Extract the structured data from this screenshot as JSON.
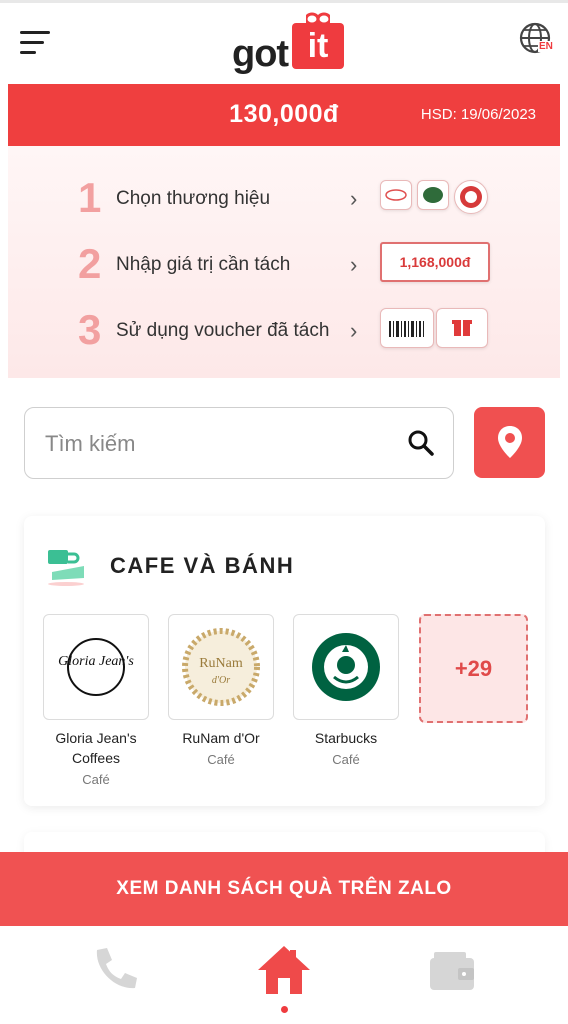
{
  "header": {
    "logo_text": "got",
    "logo_box_text": "it",
    "lang_label": "EN"
  },
  "balance": {
    "amount": "130,000đ",
    "expiry": "HSD: 19/06/2023"
  },
  "steps": [
    {
      "number": "1",
      "label": "Chọn thương hiệu",
      "arrow": "›"
    },
    {
      "number": "2",
      "label": "Nhập giá trị cần tách",
      "arrow": "›",
      "sample_value": "1,168,000đ"
    },
    {
      "number": "3",
      "label": "Sử dụng voucher đã tách",
      "arrow": "›"
    }
  ],
  "search": {
    "placeholder": "Tìm kiếm"
  },
  "category": {
    "title": "CAFE VÀ BÁNH",
    "brands": [
      {
        "name": "Gloria Jean's Coffees",
        "type": "Café",
        "logo_text": "Gloria Jean's"
      },
      {
        "name": "RuNam d'Or",
        "type": "Café",
        "logo_text": "RuNam",
        "logo_subtext": "d'Or"
      },
      {
        "name": "Starbucks",
        "type": "Café"
      }
    ],
    "more_label": "+29"
  },
  "zalo_button": "XEM DANH SÁCH QUÀ TRÊN ZALO",
  "nav": {
    "items": [
      "phone-icon",
      "home-icon",
      "wallet-icon"
    ],
    "active": "home"
  },
  "colors": {
    "brand_red": "#ef3b3f",
    "light_pink": "#fde8e8"
  }
}
